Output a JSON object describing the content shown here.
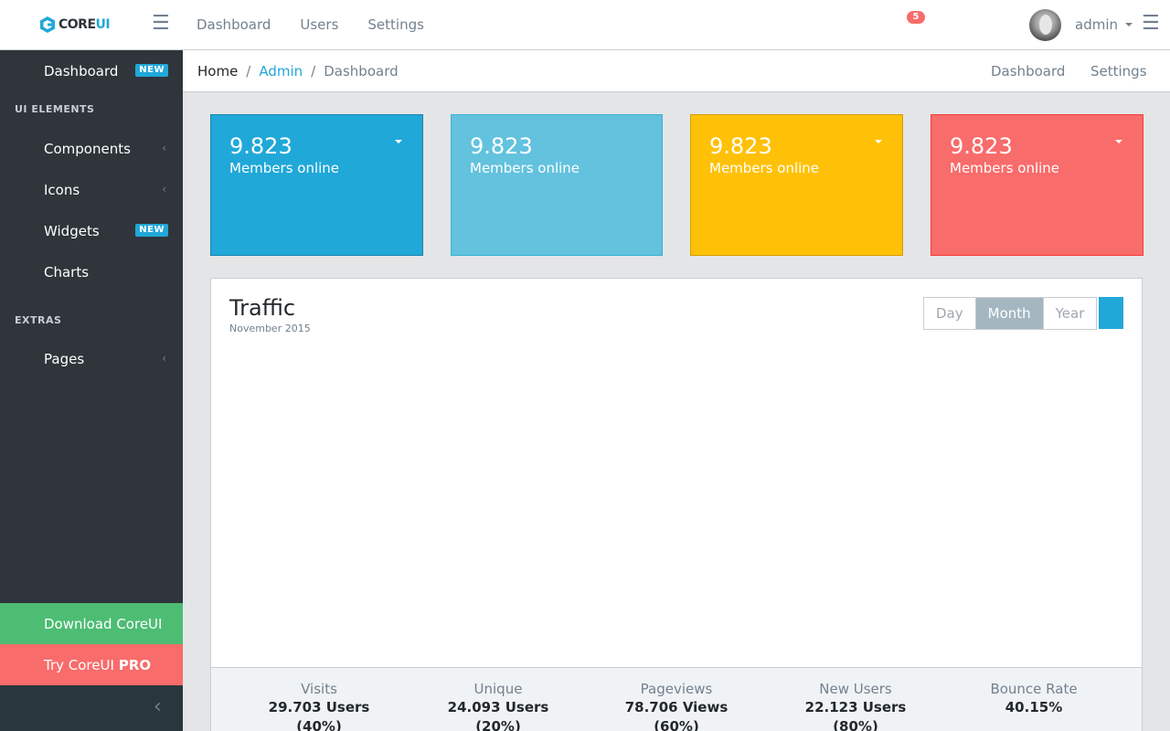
{
  "brand": {
    "name_core": "CORE",
    "name_ui": "UI"
  },
  "header": {
    "nav": [
      "Dashboard",
      "Users",
      "Settings"
    ],
    "notification_count": "5",
    "user": "admin"
  },
  "sidebar": {
    "dashboard": {
      "label": "Dashboard",
      "badge": "NEW"
    },
    "section_ui": "UI ELEMENTS",
    "components": "Components",
    "icons": "Icons",
    "widgets": {
      "label": "Widgets",
      "badge": "NEW"
    },
    "charts": "Charts",
    "section_extras": "EXTRAS",
    "pages": "Pages",
    "download": "Download CoreUI",
    "try": "Try CoreUI",
    "try_pro": "PRO"
  },
  "breadcrumb": {
    "home": "Home",
    "admin": "Admin",
    "current": "Dashboard",
    "menu": [
      "Dashboard",
      "Settings"
    ]
  },
  "cards": [
    {
      "value": "9.823",
      "label": "Members online",
      "color": "#20a8d8",
      "border": "#1985ac",
      "dropdown": true
    },
    {
      "value": "9.823",
      "label": "Members online",
      "color": "#63c2de",
      "border": "#39b2d5",
      "dropdown": false
    },
    {
      "value": "9.823",
      "label": "Members online",
      "color": "#ffc107",
      "border": "#d39e00",
      "dropdown": true
    },
    {
      "value": "9.823",
      "label": "Members online",
      "color": "#f86c6b",
      "border": "#f63c3a",
      "dropdown": true
    }
  ],
  "traffic": {
    "title": "Traffic",
    "subtitle": "November 2015",
    "periods": [
      "Day",
      "Month",
      "Year"
    ],
    "active_period": "Month",
    "stats": [
      {
        "name": "Visits",
        "value": "29.703 Users (40%)",
        "progress": 40,
        "color": "#4dbd74"
      },
      {
        "name": "Unique",
        "value": "24.093 Users (20%)",
        "progress": 20,
        "color": "#63c2de"
      },
      {
        "name": "Pageviews",
        "value": "78.706 Views (60%)",
        "progress": 60,
        "color": "#ffc107"
      },
      {
        "name": "New Users",
        "value": "22.123 Users (80%)",
        "progress": 80,
        "color": "#f86c6b"
      },
      {
        "name": "Bounce Rate",
        "value": "40.15%",
        "progress": 40.15,
        "color": "#20a8d8"
      }
    ]
  }
}
